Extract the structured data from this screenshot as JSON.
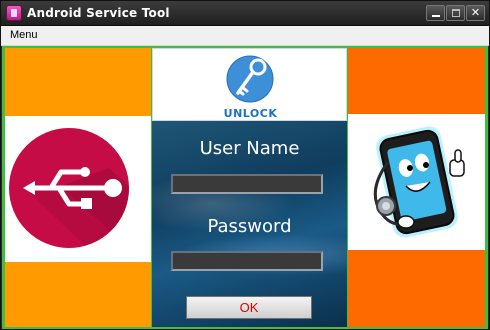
{
  "window": {
    "title": "Android Service Tool",
    "controls": {
      "minimize": "",
      "maximize": "",
      "close": "✕"
    }
  },
  "menu": {
    "items": [
      {
        "label": "Menu"
      }
    ]
  },
  "center": {
    "unlock_label": "UNLOCK",
    "username_label": "User Name",
    "username_value": "",
    "password_label": "Password",
    "password_value": "",
    "ok_label": "OK"
  },
  "colors": {
    "left_panel": "#ff9a00",
    "right_panel": "#ff6a00",
    "usb_circle": "#c60c47",
    "border_green": "#3fbf3f",
    "ok_text": "#e00000"
  },
  "icons": {
    "app": "app-icon",
    "usb": "usb-icon",
    "unlock_key": "key-icon",
    "phone_mascot": "smartphone-doctor-illustration"
  }
}
